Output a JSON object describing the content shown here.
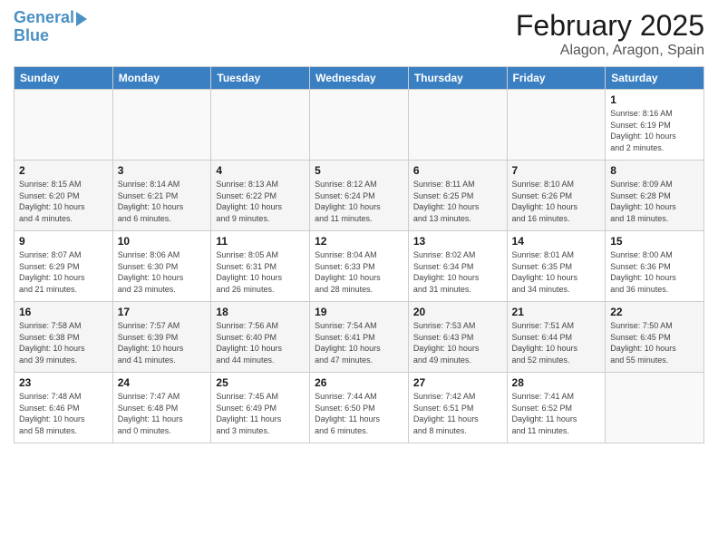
{
  "logo": {
    "line1": "General",
    "line2": "Blue"
  },
  "title": "February 2025",
  "subtitle": "Alagon, Aragon, Spain",
  "days_of_week": [
    "Sunday",
    "Monday",
    "Tuesday",
    "Wednesday",
    "Thursday",
    "Friday",
    "Saturday"
  ],
  "weeks": [
    [
      {
        "day": "",
        "info": ""
      },
      {
        "day": "",
        "info": ""
      },
      {
        "day": "",
        "info": ""
      },
      {
        "day": "",
        "info": ""
      },
      {
        "day": "",
        "info": ""
      },
      {
        "day": "",
        "info": ""
      },
      {
        "day": "1",
        "info": "Sunrise: 8:16 AM\nSunset: 6:19 PM\nDaylight: 10 hours\nand 2 minutes."
      }
    ],
    [
      {
        "day": "2",
        "info": "Sunrise: 8:15 AM\nSunset: 6:20 PM\nDaylight: 10 hours\nand 4 minutes."
      },
      {
        "day": "3",
        "info": "Sunrise: 8:14 AM\nSunset: 6:21 PM\nDaylight: 10 hours\nand 6 minutes."
      },
      {
        "day": "4",
        "info": "Sunrise: 8:13 AM\nSunset: 6:22 PM\nDaylight: 10 hours\nand 9 minutes."
      },
      {
        "day": "5",
        "info": "Sunrise: 8:12 AM\nSunset: 6:24 PM\nDaylight: 10 hours\nand 11 minutes."
      },
      {
        "day": "6",
        "info": "Sunrise: 8:11 AM\nSunset: 6:25 PM\nDaylight: 10 hours\nand 13 minutes."
      },
      {
        "day": "7",
        "info": "Sunrise: 8:10 AM\nSunset: 6:26 PM\nDaylight: 10 hours\nand 16 minutes."
      },
      {
        "day": "8",
        "info": "Sunrise: 8:09 AM\nSunset: 6:28 PM\nDaylight: 10 hours\nand 18 minutes."
      }
    ],
    [
      {
        "day": "9",
        "info": "Sunrise: 8:07 AM\nSunset: 6:29 PM\nDaylight: 10 hours\nand 21 minutes."
      },
      {
        "day": "10",
        "info": "Sunrise: 8:06 AM\nSunset: 6:30 PM\nDaylight: 10 hours\nand 23 minutes."
      },
      {
        "day": "11",
        "info": "Sunrise: 8:05 AM\nSunset: 6:31 PM\nDaylight: 10 hours\nand 26 minutes."
      },
      {
        "day": "12",
        "info": "Sunrise: 8:04 AM\nSunset: 6:33 PM\nDaylight: 10 hours\nand 28 minutes."
      },
      {
        "day": "13",
        "info": "Sunrise: 8:02 AM\nSunset: 6:34 PM\nDaylight: 10 hours\nand 31 minutes."
      },
      {
        "day": "14",
        "info": "Sunrise: 8:01 AM\nSunset: 6:35 PM\nDaylight: 10 hours\nand 34 minutes."
      },
      {
        "day": "15",
        "info": "Sunrise: 8:00 AM\nSunset: 6:36 PM\nDaylight: 10 hours\nand 36 minutes."
      }
    ],
    [
      {
        "day": "16",
        "info": "Sunrise: 7:58 AM\nSunset: 6:38 PM\nDaylight: 10 hours\nand 39 minutes."
      },
      {
        "day": "17",
        "info": "Sunrise: 7:57 AM\nSunset: 6:39 PM\nDaylight: 10 hours\nand 41 minutes."
      },
      {
        "day": "18",
        "info": "Sunrise: 7:56 AM\nSunset: 6:40 PM\nDaylight: 10 hours\nand 44 minutes."
      },
      {
        "day": "19",
        "info": "Sunrise: 7:54 AM\nSunset: 6:41 PM\nDaylight: 10 hours\nand 47 minutes."
      },
      {
        "day": "20",
        "info": "Sunrise: 7:53 AM\nSunset: 6:43 PM\nDaylight: 10 hours\nand 49 minutes."
      },
      {
        "day": "21",
        "info": "Sunrise: 7:51 AM\nSunset: 6:44 PM\nDaylight: 10 hours\nand 52 minutes."
      },
      {
        "day": "22",
        "info": "Sunrise: 7:50 AM\nSunset: 6:45 PM\nDaylight: 10 hours\nand 55 minutes."
      }
    ],
    [
      {
        "day": "23",
        "info": "Sunrise: 7:48 AM\nSunset: 6:46 PM\nDaylight: 10 hours\nand 58 minutes."
      },
      {
        "day": "24",
        "info": "Sunrise: 7:47 AM\nSunset: 6:48 PM\nDaylight: 11 hours\nand 0 minutes."
      },
      {
        "day": "25",
        "info": "Sunrise: 7:45 AM\nSunset: 6:49 PM\nDaylight: 11 hours\nand 3 minutes."
      },
      {
        "day": "26",
        "info": "Sunrise: 7:44 AM\nSunset: 6:50 PM\nDaylight: 11 hours\nand 6 minutes."
      },
      {
        "day": "27",
        "info": "Sunrise: 7:42 AM\nSunset: 6:51 PM\nDaylight: 11 hours\nand 8 minutes."
      },
      {
        "day": "28",
        "info": "Sunrise: 7:41 AM\nSunset: 6:52 PM\nDaylight: 11 hours\nand 11 minutes."
      },
      {
        "day": "",
        "info": ""
      }
    ]
  ]
}
